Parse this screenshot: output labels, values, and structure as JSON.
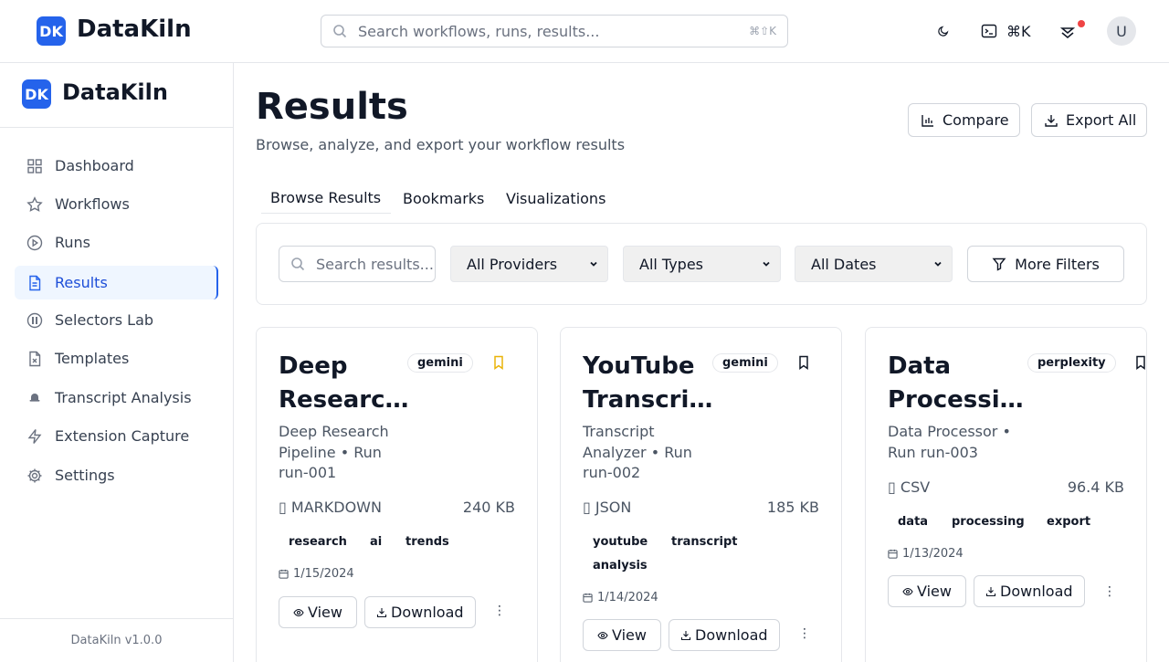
{
  "app": {
    "logo_mark": "DK",
    "name": "DataKiln",
    "version": "DataKiln v1.0.0"
  },
  "header": {
    "search_placeholder": "Search workflows, runs, results...",
    "search_shortcut": "⌘⇧K",
    "command_shortcut": "⌘K",
    "avatar_initial": "U",
    "icons": [
      "search-icon",
      "moon-icon",
      "terminal-icon",
      "notifications-icon"
    ],
    "notification_dot_color": "#ef4444"
  },
  "sidebar": {
    "items": [
      {
        "label": "Dashboard",
        "icon": "grid-icon"
      },
      {
        "label": "Workflows",
        "icon": "star-icon"
      },
      {
        "label": "Runs",
        "icon": "play-circle-icon"
      },
      {
        "label": "Results",
        "icon": "file-text-icon",
        "active": true
      },
      {
        "label": "Selectors Lab",
        "icon": "target-icon"
      },
      {
        "label": "Templates",
        "icon": "file-x-icon"
      },
      {
        "label": "Transcript Analysis",
        "icon": "bot-icon"
      },
      {
        "label": "Extension Capture",
        "icon": "bolt-icon"
      },
      {
        "label": "Settings",
        "icon": "gear-icon"
      }
    ]
  },
  "page": {
    "title": "Results",
    "subtitle": "Browse, analyze, and export your workflow results",
    "compare_label": "Compare",
    "export_label": "Export All",
    "tabs": [
      "Browse Results",
      "Bookmarks",
      "Visualizations"
    ],
    "active_tab": "Browse Results"
  },
  "filters": {
    "search_placeholder": "Search results...",
    "providers": "All Providers",
    "types": "All Types",
    "dates": "All Dates",
    "more_label": "More Filters"
  },
  "cards": [
    {
      "title_line1": "Deep",
      "title_line2": "Researc…",
      "provider": "gemini",
      "bookmarked": true,
      "desc_lines": [
        "Deep Research",
        "Pipeline • Run",
        "run-001"
      ],
      "format": "MARKDOWN",
      "size": "240 KB",
      "tags": [
        "research",
        "ai",
        "trends"
      ],
      "date": "1/15/2024",
      "view_label": "View",
      "download_label": "Download",
      "more_glyph": "⋮",
      "format_icon": "file-icon"
    },
    {
      "title_line1": "YouTube",
      "title_line2": "Transcri…",
      "provider": "gemini",
      "bookmarked": false,
      "desc_lines": [
        "Transcript",
        "Analyzer • Run",
        "run-002"
      ],
      "format": "JSON",
      "size": "185 KB",
      "tags": [
        "youtube",
        "transcript",
        "analysis"
      ],
      "date": "1/14/2024",
      "view_label": "View",
      "download_label": "Download",
      "more_glyph": "⋮",
      "format_icon": "file-icon"
    },
    {
      "title_line1": "Data",
      "title_line2": "Processi…",
      "provider": "perplexity",
      "bookmarked": false,
      "desc_lines": [
        "Data Processor •",
        "Run run-003"
      ],
      "format": "CSV",
      "size": "96.4 KB",
      "tags": [
        "data",
        "processing",
        "export"
      ],
      "date": "1/13/2024",
      "view_label": "View",
      "download_label": "Download",
      "more_glyph": "⋮",
      "format_icon": "file-icon"
    }
  ],
  "colors": {
    "brand": "#2563eb",
    "bookmark_active": "#eab308",
    "active_nav_bg": "#eff6ff"
  }
}
